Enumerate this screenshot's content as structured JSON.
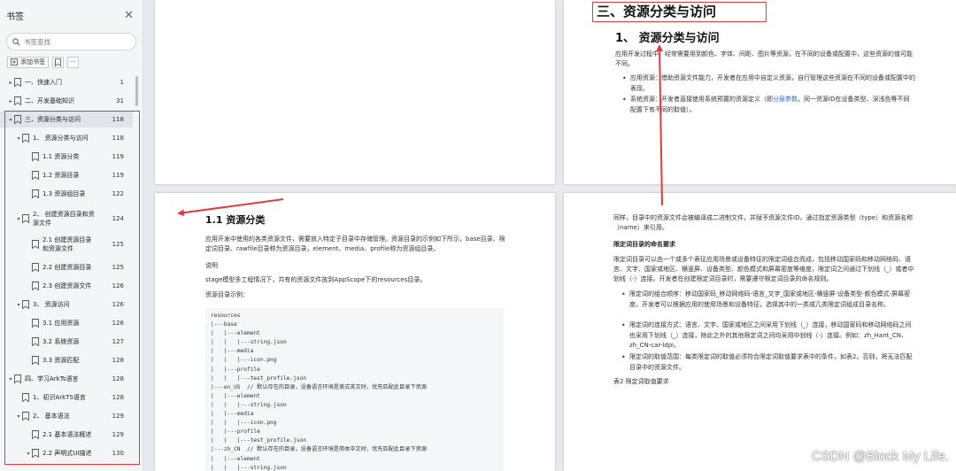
{
  "sidebar": {
    "title": "书签",
    "close_glyph": "✕",
    "search_placeholder": "书签查找",
    "add_label": "添加书签",
    "more_glyph": "···",
    "items": [
      {
        "label": "一、快速入门",
        "page": "1",
        "level": 0,
        "caret": "▸",
        "selected": false
      },
      {
        "label": "二、开发基础知识",
        "page": "31",
        "level": 0,
        "caret": "▸",
        "selected": false
      },
      {
        "label": "三、资源分类与访问",
        "page": "118",
        "level": 0,
        "caret": "▾",
        "selected": true
      },
      {
        "label": "1、 资源分类与访问",
        "page": "118",
        "level": 1,
        "caret": "▾",
        "selected": false
      },
      {
        "label": "1.1 资源分类",
        "page": "119",
        "level": 2,
        "caret": "",
        "selected": false
      },
      {
        "label": "1.2 资源目录",
        "page": "119",
        "level": 2,
        "caret": "",
        "selected": false
      },
      {
        "label": "1.3 资源组目录",
        "page": "122",
        "level": 2,
        "caret": "",
        "selected": false
      },
      {
        "label": "2、 创建资源目录和资源文件",
        "page": "124",
        "level": 1,
        "caret": "▾",
        "selected": false
      },
      {
        "label": "2.1 创建资源目录和资源文件",
        "page": "125",
        "level": 2,
        "caret": "",
        "selected": false
      },
      {
        "label": "2.2 创建资源目录",
        "page": "125",
        "level": 2,
        "caret": "",
        "selected": false
      },
      {
        "label": "2.3 创建资源文件",
        "page": "126",
        "level": 2,
        "caret": "",
        "selected": false
      },
      {
        "label": "3、 资源访问",
        "page": "126",
        "level": 1,
        "caret": "▾",
        "selected": false
      },
      {
        "label": "3.1 应用资源",
        "page": "126",
        "level": 2,
        "caret": "",
        "selected": false
      },
      {
        "label": "3.2 系统资源",
        "page": "127",
        "level": 2,
        "caret": "",
        "selected": false
      },
      {
        "label": "3.3 资源匹配",
        "page": "128",
        "level": 2,
        "caret": "",
        "selected": false
      },
      {
        "label": "四、学习ArkTs语言",
        "page": "128",
        "level": 0,
        "caret": "▾",
        "selected": false
      },
      {
        "label": "1、初识ArkTS语言",
        "page": "128",
        "level": 1,
        "caret": "",
        "selected": false
      },
      {
        "label": "2、 基本语法",
        "page": "129",
        "level": 1,
        "caret": "▾",
        "selected": false
      },
      {
        "label": "2.1 基本语法概述",
        "page": "129",
        "level": 2,
        "caret": "",
        "selected": false
      },
      {
        "label": "2.2 声明式UI描述",
        "page": "130",
        "level": 2,
        "caret": "▾",
        "selected": false
      }
    ]
  },
  "page_top_right": {
    "title_boxed": "三、资源分类与访问",
    "heading": "1、 资源分类与访问",
    "intro": "应用开发过程中，经常需要用到颜色、字体、间距、图片等资源，在不同的设备或配置中，这些资源的值可能不同。",
    "bullet1": "应用资源：借助资源文件能力，开发者在应用中自定义资源，自行管理这些资源在不同的设备或配置中的表现。",
    "bullet2_pre": "系统资源：开发者直接使用系统预置的资源定义（即",
    "bullet2_link": "分层参数",
    "bullet2_post": "，同一资源ID在设备类型、深浅色等不同配置下有不同的取值）。"
  },
  "page_bottom_left": {
    "heading": "1.1 资源分类",
    "intro": "应用开发中使用的各类资源文件，需要放入特定子目录中存储管理。资源目录的示例如下所示，base目录、限定词目录、rawfile目录称为资源目录，element、media、profile称为资源组目录。",
    "note": "说明",
    "stage": "stage模型多工程情况下，共有的资源文件放到AppScope下的resources目录。",
    "example_label": "资源目录示例：",
    "code": "resources\n|---base\n|   |---element\n|   |   |---string.json\n|   |---media\n|   |   |---icon.png\n|   |---profile\n|   |   |---test_profile.json\n|---en_US  // 默认存在的目录，设备语言环境是美式英文时，优先匹配此目录下资源\n|   |---element\n|   |   |---string.json\n|   |---media\n|   |   |---icon.png\n|   |---profile\n|   |   |---test_profile.json\n|---zh_CN  // 默认存在的目录，设备语言环境是简体中文时，优先匹配此目录下资源\n|   |---element\n|   |   |---string.json"
  },
  "page_bottom_right": {
    "intro": "同样，目录中的资源文件会被编译成二进制文件，并赋予资源文件ID。通过指定资源类型（type）和资源名称（name）来引用。",
    "subtitle": "限定词目录的命名要求",
    "para": "限定词目录可以由一个或多个表征应用场景或设备特征的限定词组合而成，包括移动国家码和移动网络码、语言、文字、国家或地区、横竖屏、设备类型、颜色模式和屏幕密度等维度，限定词之间通过下划线（_）或者中划线（-）连接。开发者在创建限定词目录时，需要遵守限定词目录的命名规则。",
    "b1": "限定词的组合顺序：移动国家码_移动网络码-语言_文字_国家或地区-横竖屏-设备类型-颜色模式-屏幕密度。开发者可以根据应用的使用场景和设备特征，选择其中的一类或几类限定词组成目录名称。",
    "b2": "限定词的连接方式：语言、文字、国家或地区之间采用下划线（_）连接，移动国家码和移动网络码之间也采用下划线（_）连接，除此之外的其他限定词之间均采用中划线（-）连接。例如：zh_Hant_CN、zh_CN-car-ldpi。",
    "b3": "限定词的取值范围：每类限定词的取值必须符合限定词取值要求表中的条件，如表2。否则，将无法匹配目录中的资源文件。",
    "table_caption": "表2 限定词取值要求"
  },
  "watermark": "CSDN @Block My Life.",
  "colors": {
    "highlight_red": "#e23a3f",
    "link_blue": "#3366cc",
    "sidebar_bg": "#f4f5f7",
    "canvas_bg": "#e7e9ed"
  }
}
